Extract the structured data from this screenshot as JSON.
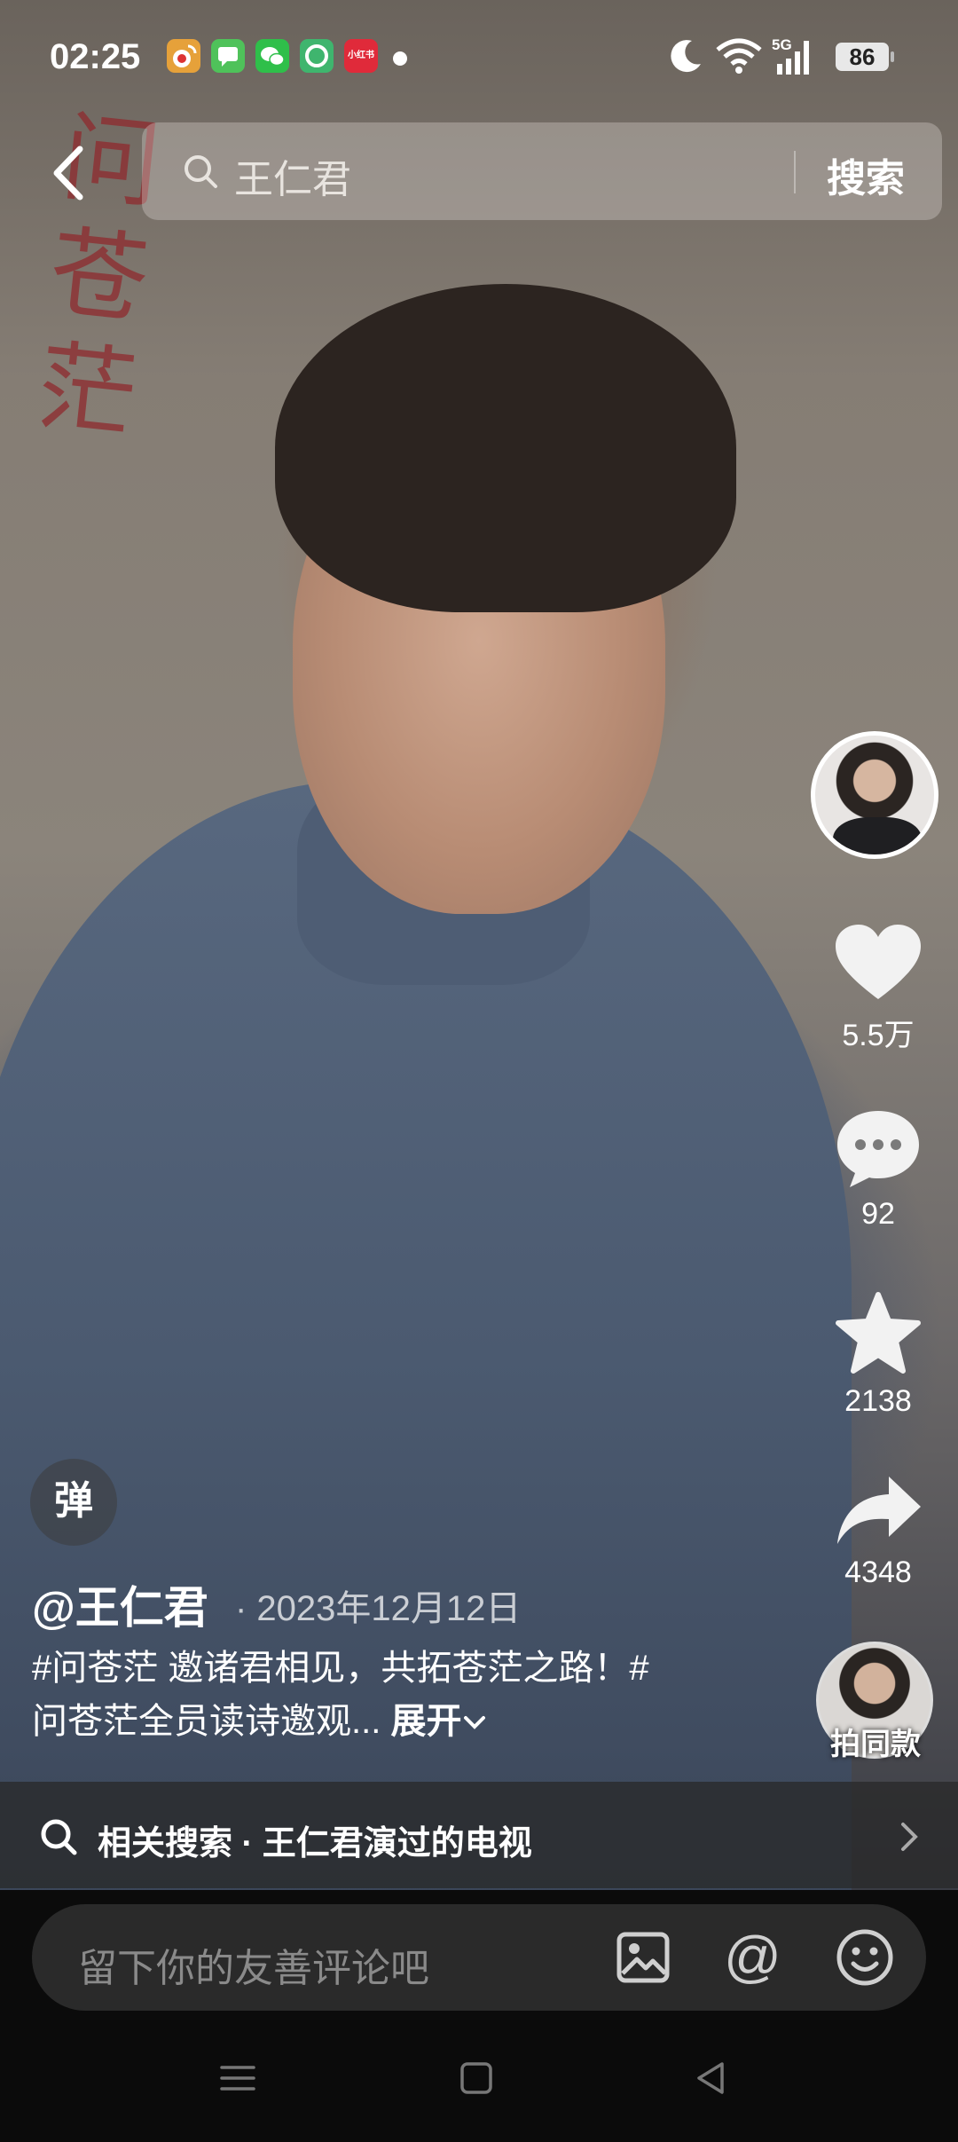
{
  "status_bar": {
    "time": "02:25",
    "notification_icons": [
      {
        "name": "weibo-icon",
        "color": "#e6a13a",
        "label": ""
      },
      {
        "name": "messages-icon",
        "color": "#4fc25a",
        "label": ""
      },
      {
        "name": "wechat-icon",
        "color": "#2fbf4a",
        "label": ""
      },
      {
        "name": "app-icon",
        "color": "#3fb56e",
        "label": ""
      },
      {
        "name": "xiaohongshu-icon",
        "color": "#e02a3a",
        "label": "小红书"
      }
    ],
    "network": "5G",
    "battery": "86"
  },
  "search": {
    "query": "王仁君",
    "button_label": "搜索"
  },
  "video": {
    "watermark_text": "问苍茫"
  },
  "actions": {
    "likes": "5.5万",
    "comments": "92",
    "favorites": "2138",
    "shares": "4348",
    "same_style_label": "拍同款"
  },
  "danmaku_label": "弹",
  "post": {
    "author": "@王仁君",
    "date": "· 2023年12月12日",
    "caption": "#问苍茫 邀诸君相见，共拓苍茫之路！#问苍茫全员读诗邀观...",
    "expand_label": "展开"
  },
  "related_search": {
    "label": "相关搜索 · 王仁君演过的电视"
  },
  "comment_input": {
    "placeholder": "留下你的友善评论吧"
  },
  "colors": {
    "background": "#000000",
    "comment_bar": "#2a2a2a",
    "accent_text": "#ffffff"
  }
}
